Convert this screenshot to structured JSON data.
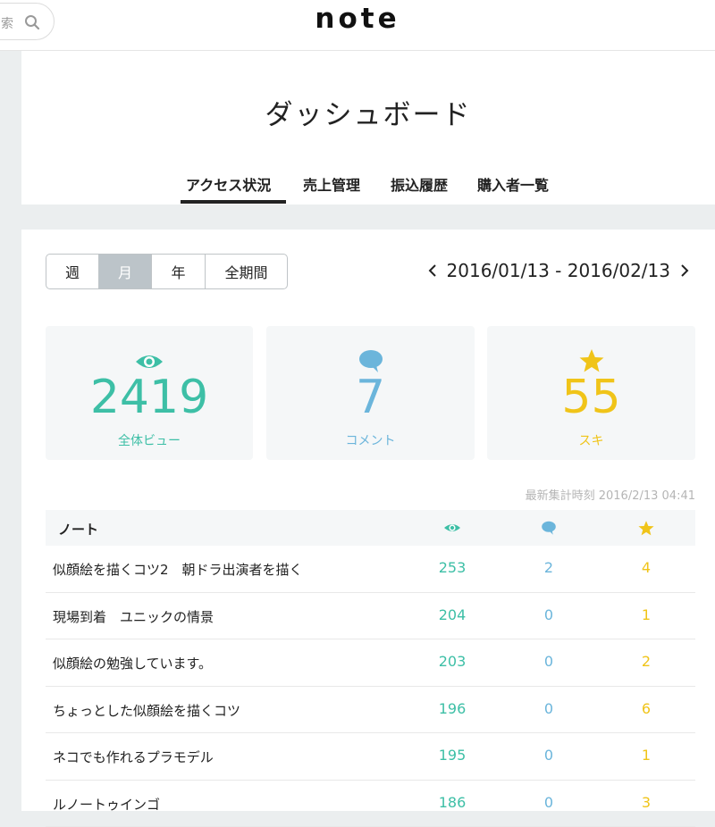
{
  "topbar": {
    "search_text": "索",
    "logo": "note"
  },
  "header": {
    "title": "ダッシュボード",
    "tabs": [
      {
        "label": "アクセス状況",
        "active": true
      },
      {
        "label": "売上管理",
        "active": false
      },
      {
        "label": "振込履歴",
        "active": false
      },
      {
        "label": "購入者一覧",
        "active": false
      }
    ]
  },
  "period": {
    "options": [
      {
        "label": "週",
        "active": false
      },
      {
        "label": "月",
        "active": true
      },
      {
        "label": "年",
        "active": false
      },
      {
        "label": "全期間",
        "active": false
      }
    ],
    "date_range": "2016/01/13 - 2016/02/13"
  },
  "stats": {
    "views": {
      "value": "2419",
      "label": "全体ビュー",
      "icon": "eye-icon",
      "color": "#3dbfa6"
    },
    "comments": {
      "value": "7",
      "label": "コメント",
      "icon": "comment-icon",
      "color": "#6bb5db"
    },
    "likes": {
      "value": "55",
      "label": "スキ",
      "icon": "star-icon",
      "color": "#f0c419"
    }
  },
  "last_updated": "最新集計時刻 2016/2/13 04:41",
  "table": {
    "header": {
      "note": "ノート"
    },
    "rows": [
      {
        "title": "似顔絵を描くコツ2　朝ドラ出演者を描く",
        "views": "253",
        "comments": "2",
        "likes": "4"
      },
      {
        "title": "現場到着　ユニックの情景",
        "views": "204",
        "comments": "0",
        "likes": "1"
      },
      {
        "title": "似顔絵の勉強しています。",
        "views": "203",
        "comments": "0",
        "likes": "2"
      },
      {
        "title": "ちょっとした似顔絵を描くコツ",
        "views": "196",
        "comments": "0",
        "likes": "6"
      },
      {
        "title": "ネコでも作れるプラモデル",
        "views": "195",
        "comments": "0",
        "likes": "1"
      },
      {
        "title": "ルノートゥインゴ",
        "views": "186",
        "comments": "0",
        "likes": "3"
      }
    ]
  }
}
